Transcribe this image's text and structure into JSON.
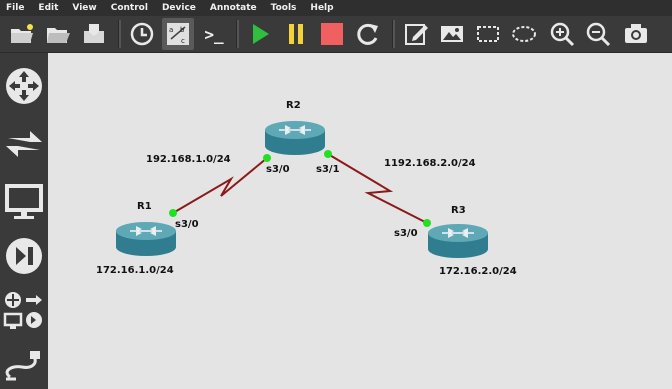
{
  "menu": [
    "File",
    "Edit",
    "View",
    "Control",
    "Device",
    "Annotate",
    "Tools",
    "Help"
  ],
  "toolbar": {
    "console_prompt": ">_"
  },
  "topology": {
    "routers": [
      {
        "name": "R1",
        "network": "172.16.1.0/24"
      },
      {
        "name": "R2"
      },
      {
        "name": "R3",
        "network": "172.16.2.0/24"
      }
    ],
    "links": [
      {
        "network": "192.168.1.0/24",
        "a_port": "s3/0",
        "b_port": "s3/0"
      },
      {
        "network": "1192.168.2.0/24",
        "a_port": "s3/1",
        "b_port": "s3/0"
      }
    ]
  },
  "colors": {
    "link": "#8b1a1a",
    "port_dot": "#22e022",
    "router_top": "#5fa8b6",
    "router_side": "#2f7d8e",
    "start": "#2fbf3f",
    "suspend": "#f3d23a",
    "stop": "#f06060"
  }
}
